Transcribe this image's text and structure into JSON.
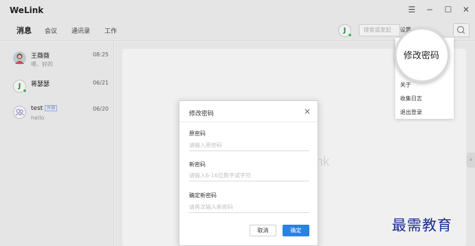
{
  "app": {
    "title": "WeLink"
  },
  "window_controls": {
    "menu": "☰",
    "minimize": "−",
    "maximize": "☐",
    "close": "✕"
  },
  "nav": {
    "tabs": [
      "消息",
      "会议",
      "通讯录",
      "工作"
    ],
    "avatar_letter": "J",
    "search_placeholder": "搜索或发起",
    "settings_label": "设置"
  },
  "conversations": [
    {
      "name": "王薇薇",
      "message": "嗯、好的",
      "time": "08:25"
    },
    {
      "name": "蒋瑟瑟",
      "message": "",
      "time": "06/21",
      "avatar_letter": "J"
    },
    {
      "name": "test",
      "badge": "外部",
      "message": "hello",
      "time": "06/20"
    }
  ],
  "brand_watermark": "nk",
  "settings_menu": {
    "highlight": "修改密码",
    "items": [
      "关于",
      "收集日志",
      "退出登录"
    ]
  },
  "dialog": {
    "title": "修改密码",
    "close": "×",
    "fields": [
      {
        "label": "原密码",
        "placeholder": "请输入原密码"
      },
      {
        "label": "新密码",
        "placeholder": "请输入6-16位数字或字符"
      },
      {
        "label": "确定新密码",
        "placeholder": "请再次输入新密码"
      }
    ],
    "cancel": "取消",
    "ok": "确定"
  },
  "corner_watermark": "最需教育",
  "colors": {
    "primary": "#2a82e4",
    "online": "#3fbf5f",
    "sidebar_bg": "#f4f4f4"
  }
}
